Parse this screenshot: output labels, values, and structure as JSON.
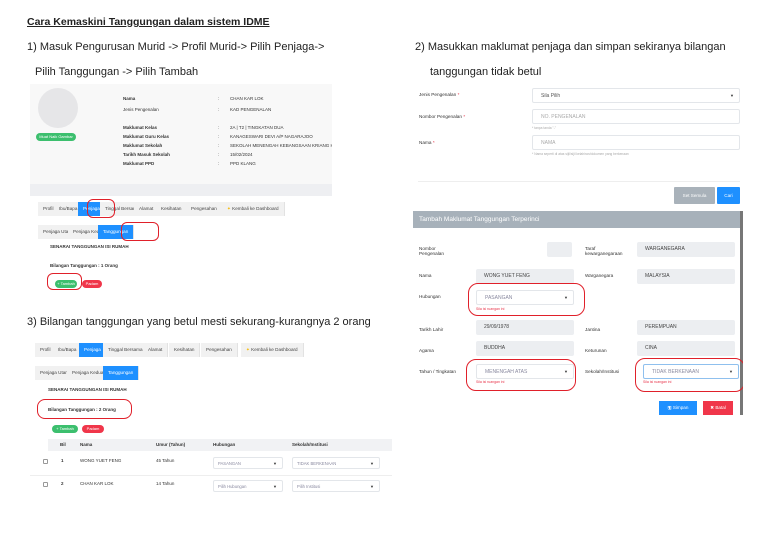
{
  "title": "Cara Kemaskini Tanggungan dalam sistem IDME",
  "step1": {
    "line1": "1) Masuk Pengurusan Murid -> Profil Murid-> Pilih Penjaga->",
    "line2": "Pilih Tanggungan -> Pilih Tambah"
  },
  "step2": {
    "line1": "2) Masukkan maklumat penjaga dan simpan sekiranya bilangan",
    "line2": "tanggungan tidak betul"
  },
  "step3": {
    "line1": "3) Bilangan tanggungan yang betul mesti sekurang-kurangnya 2 orang"
  },
  "profile": {
    "photo_button": "Muat Naik Gambar",
    "fields": [
      {
        "label": "Nama",
        "value": "CHAN KAR LOK"
      },
      {
        "label": "Jenis Pengenalan",
        "value": "KAD PENGENALAN"
      },
      {
        "label": "Maklumat Kelas",
        "value": "2A | T2 | TINGKATAN DUA"
      },
      {
        "label": "Maklumat Guru Kelas",
        "value": "KANAGESWARI DEVI A/P NAGARAJOO"
      },
      {
        "label": "Maklumat Sekolah",
        "value": "SEKOLAH MENENGAH KEBANGSAAN KRIANG HUA"
      },
      {
        "label": "Tarikh Masuk Sekolah",
        "value": "15/02/2024"
      },
      {
        "label": "Maklumat PPD",
        "value": "PPD KLANG"
      }
    ],
    "sep": ":"
  },
  "tabs": [
    "Profil",
    "Ibu/Bapa",
    "Penjaga",
    "Tinggal Bersama",
    "Alamat",
    "Kesihatan",
    "Pengesahan",
    "Kembali ke Dashboard"
  ],
  "subtabs": [
    "Penjaga Utama",
    "Penjaga Kedua",
    "Tanggungan"
  ],
  "list_title": "SENARAI TANGGUNGAN ISI RUMAH",
  "count1": "Bilangan Tanggungan : 1 Orang",
  "count2": "Bilangan Tanggungan : 2 Orang",
  "add_button": "+ Tambah",
  "delete_button": "Padam",
  "table": {
    "headers": [
      "Bil",
      "Nama",
      "Umur (Tahun)",
      "Hubungan",
      "Sekolah/Institusi"
    ],
    "rows": [
      {
        "no": "1",
        "name": "WONG YUET FENG",
        "age": "45 Tahun",
        "rel": "PASANGAN",
        "school": "TIDAK BERKENAAN"
      },
      {
        "no": "2",
        "name": "CHAN KAR LOK",
        "age": "14 Tahun",
        "rel": "Pilih Hubungan",
        "school": "Pilih Institusi"
      }
    ]
  },
  "search_form": {
    "id_type_label": "Jenis Pengenalan",
    "id_type_value": "Sila Pilih",
    "id_no_label": "Nombor Pengenalan",
    "id_no_placeholder": "NO. PENGENALAN",
    "id_no_hint": "* tanpa tanda \"-\"",
    "name_label": "Nama",
    "name_placeholder": "NAMA",
    "name_hint": "* Nama seperti di atas sijil/sijil kelahiran/dokumen yang berkenaan",
    "required": "*",
    "reset": "Set Semula",
    "search": "Cari"
  },
  "detail": {
    "header": "Tambah Maklumat Tanggungan Terperinci",
    "id_no_label": "Nombor Pengenalan",
    "citizen_status_label": "Taraf kewarganegaraan",
    "citizen_status": "WARGANEGARA",
    "name_label": "Nama",
    "name": "WONG YUET FENG",
    "nationality_label": "Warganegara",
    "nationality": "MALAYSIA",
    "relation_label": "Hubungan",
    "relation": "PASANGAN",
    "dob_label": "Tarikh Lahir",
    "dob": "29/09/1978",
    "gender_label": "Jantina",
    "gender": "PEREMPUAN",
    "religion_label": "Agama",
    "religion": "BUDDHA",
    "race_label": "Keturunan",
    "race": "CINA",
    "level_label": "Tahun / Tingkatan",
    "level": "MENENGAH ATAS",
    "school_label": "Sekolah/Institusi",
    "school": "TIDAK BERKENAAN",
    "error": "Sila isi ruangan ini",
    "save": "Simpan",
    "cancel": "Batal"
  }
}
